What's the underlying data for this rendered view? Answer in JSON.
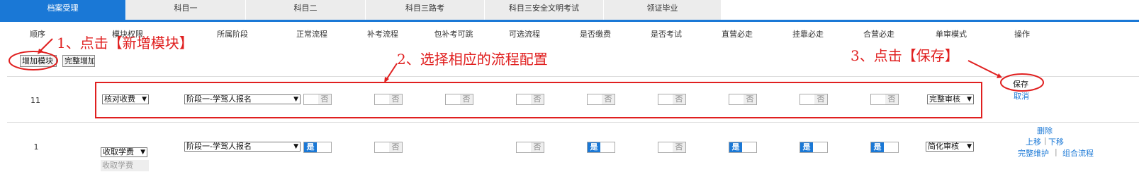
{
  "tabs": [
    "档案受理",
    "科目一",
    "科目二",
    "科目三路考",
    "科目三安全文明考试",
    "领证毕业"
  ],
  "headers": [
    "顺序",
    "模块权限",
    "所属阶段",
    "正常流程",
    "补考流程",
    "包补考可跳",
    "可选流程",
    "是否缴费",
    "是否考试",
    "直营必走",
    "挂靠必走",
    "合营必走",
    "单审模式",
    "操作"
  ],
  "toolbar": {
    "add_module": "增加模块",
    "full_add": "完整增加"
  },
  "row_edit": {
    "order": "11",
    "module": "核对收费",
    "stage": "阶段一-学驾人报名",
    "toggle_off": "否",
    "mode": "完整审核",
    "save": "保存",
    "cancel": "取消"
  },
  "row_1": {
    "order": "1",
    "module": "收取学费",
    "module_below": "收取学费",
    "stage": "阶段一-学驾人报名",
    "toggle_on": "是",
    "toggle_off": "否",
    "mode": "简化审核",
    "delete": "删除",
    "up": "上移",
    "down": "下移",
    "pipe": "|",
    "maintain": "完整维护",
    "combine": "组合流程"
  },
  "annotations": {
    "a1": "1、点击【新增模块】",
    "a2": "2、选择相应的流程配置",
    "a3": "3、点击【保存】"
  },
  "colors": {
    "accent": "#1a78d6",
    "annotation": "#e02020"
  }
}
